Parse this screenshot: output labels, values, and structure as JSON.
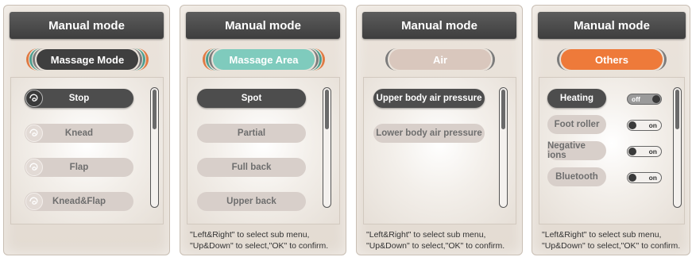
{
  "panels": [
    {
      "title": "Manual mode",
      "mode_label": "Massage Mode",
      "items": [
        "Stop",
        "Knead",
        "Flap",
        "Knead&Flap"
      ],
      "instructions": []
    },
    {
      "title": "Manual mode",
      "mode_label": "Massage Area",
      "items": [
        "Spot",
        "Partial",
        "Full back",
        "Upper back"
      ],
      "instructions": [
        "\"Left&Right\" to select sub menu,",
        "\"Up&Down\" to select,\"OK\" to confirm."
      ]
    },
    {
      "title": "Manual mode",
      "mode_label": "Air",
      "items": [
        "Upper body air pressure",
        "Lower body air pressure"
      ],
      "instructions": [
        "\"Left&Right\" to select sub menu,",
        "\"Up&Down\" to select,\"OK\" to confirm."
      ]
    },
    {
      "title": "Manual mode",
      "mode_label": "Others",
      "items": [
        "Heating",
        "Foot roller",
        "Negative ions",
        "Bluetooth"
      ],
      "toggles": [
        "off",
        "on",
        "on",
        "on"
      ],
      "instructions": [
        "\"Left&Right\" to select sub menu,",
        "\"Up&Down\" to select,\"OK\" to confirm."
      ]
    }
  ],
  "colors": {
    "title_bg": "#4a4a4a",
    "mode_dark": "#3f3f3f",
    "mode_teal": "#7fcbbd",
    "mode_beige": "#d9c7bd",
    "mode_orange": "#ee7a3a",
    "item_active": "#4d4d4d",
    "item_inactive": "#d8cfca"
  },
  "icons": [
    "massage-swirl-icon"
  ]
}
